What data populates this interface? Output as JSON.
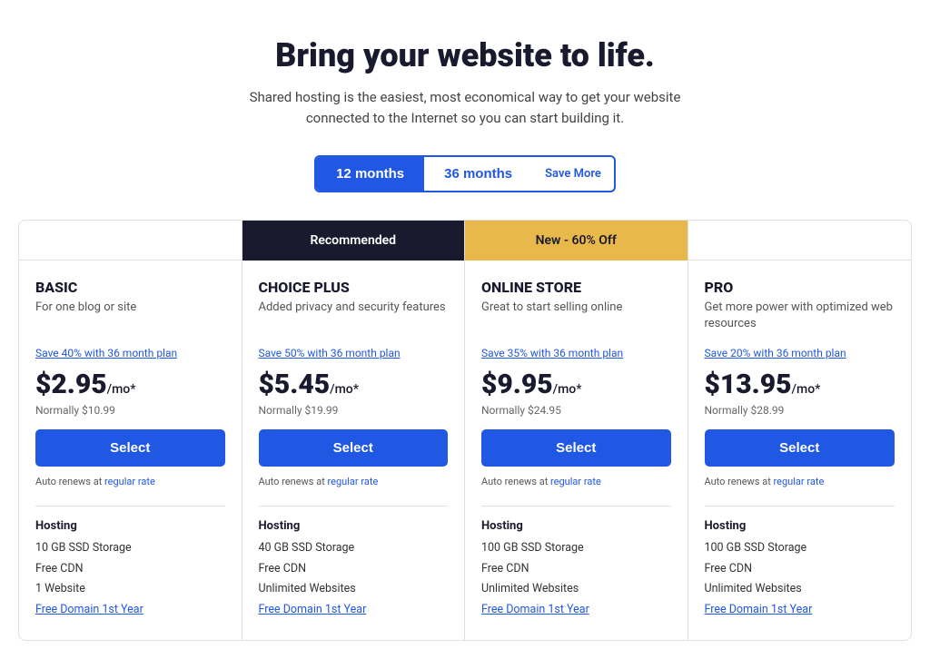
{
  "hero": {
    "title": "Bring your website to life.",
    "description": "Shared hosting is the easiest, most economical way to get your website connected to the Internet so you can start building it."
  },
  "billing": {
    "option1_label": "12 months",
    "option2_label": "36 months",
    "save_label": "Save More",
    "active": "12months"
  },
  "plans": [
    {
      "badge": "",
      "badge_type": "empty",
      "name": "BASIC",
      "tagline": "For one blog or site",
      "save_text": "Save 40% with 36 month plan",
      "price": "$2.95",
      "per": "/mo*",
      "normal": "Normally $10.99",
      "select_label": "Select",
      "auto_renew": "Auto renews at",
      "auto_renew_link": "regular rate",
      "features_label": "Hosting",
      "features": [
        "10 GB SSD Storage",
        "Free CDN",
        "1 Website",
        "Free Domain 1st Year"
      ],
      "feature_blue": [
        false,
        false,
        false,
        true
      ]
    },
    {
      "badge": "Recommended",
      "badge_type": "recommended",
      "name": "CHOICE PLUS",
      "tagline": "Added privacy and security features",
      "save_text": "Save 50% with 36 month plan",
      "price": "$5.45",
      "per": "/mo*",
      "normal": "Normally $19.99",
      "select_label": "Select",
      "auto_renew": "Auto renews at",
      "auto_renew_link": "regular rate",
      "features_label": "Hosting",
      "features": [
        "40 GB SSD Storage",
        "Free CDN",
        "Unlimited Websites",
        "Free Domain 1st Year"
      ],
      "feature_blue": [
        false,
        false,
        false,
        true
      ]
    },
    {
      "badge": "New - 60% Off",
      "badge_type": "new-offer",
      "name": "ONLINE STORE",
      "tagline": "Great to start selling online",
      "save_text": "Save 35% with 36 month plan",
      "price": "$9.95",
      "per": "/mo*",
      "normal": "Normally $24.95",
      "select_label": "Select",
      "auto_renew": "Auto renews at",
      "auto_renew_link": "regular rate",
      "features_label": "Hosting",
      "features": [
        "100 GB SSD Storage",
        "Free CDN",
        "Unlimited Websites",
        "Free Domain 1st Year"
      ],
      "feature_blue": [
        false,
        false,
        false,
        true
      ]
    },
    {
      "badge": "",
      "badge_type": "empty",
      "name": "PRO",
      "tagline": "Get more power with optimized web resources",
      "save_text": "Save 20% with 36 month plan",
      "price": "$13.95",
      "per": "/mo*",
      "normal": "Normally $28.99",
      "select_label": "Select",
      "auto_renew": "Auto renews at",
      "auto_renew_link": "regular rate",
      "features_label": "Hosting",
      "features": [
        "100 GB SSD Storage",
        "Free CDN",
        "Unlimited Websites",
        "Free Domain 1st Year"
      ],
      "feature_blue": [
        false,
        false,
        false,
        true
      ]
    }
  ]
}
